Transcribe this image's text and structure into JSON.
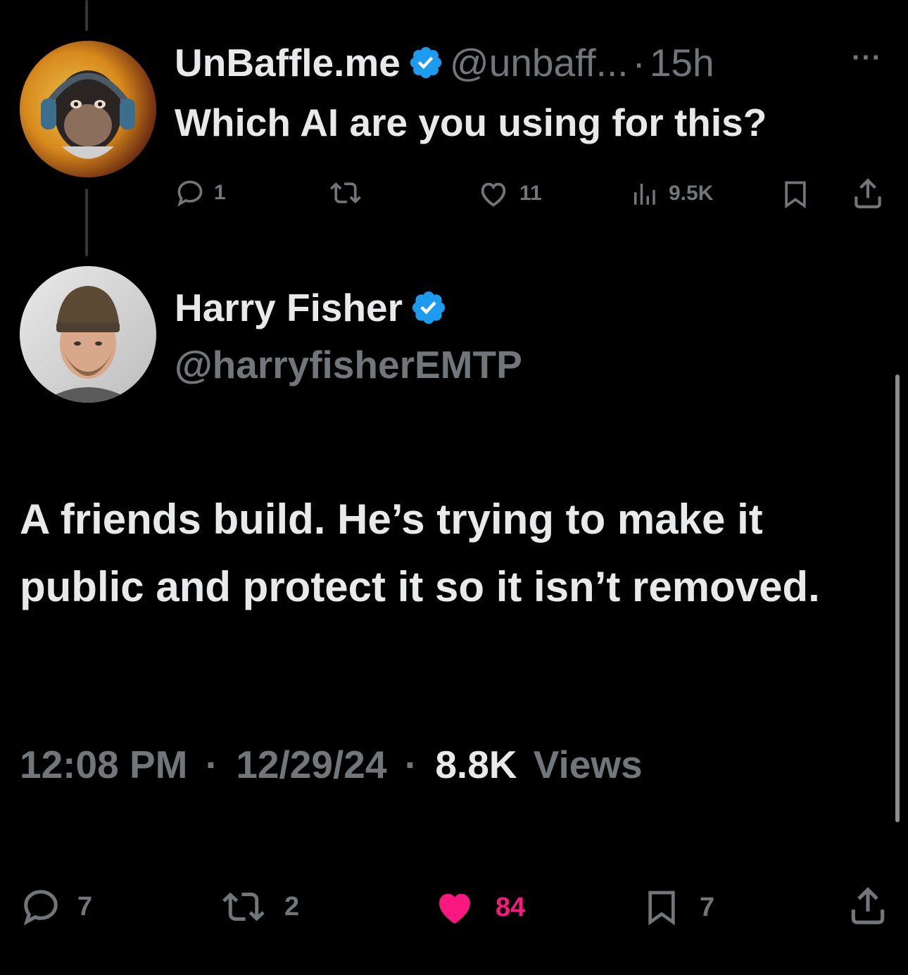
{
  "reply": {
    "display_name": "UnBaffle.me",
    "handle": "@unbaff...",
    "separator": "·",
    "time": "15h",
    "more_label": "···",
    "text": "Which AI are you using for this?",
    "actions": {
      "replies": "1",
      "reposts": "",
      "likes": "11",
      "views": "9.5K"
    }
  },
  "main": {
    "display_name": "Harry Fisher",
    "handle": "@harryfisherEMTP",
    "text": "A friends build. He’s trying to make it public and protect it so it isn’t removed.",
    "timestamp": {
      "time": "12:08 PM",
      "sep1": "·",
      "date": "12/29/24",
      "sep2": "·",
      "views_count": "8.8K",
      "views_label": "Views"
    },
    "actions": {
      "replies": "7",
      "reposts": "2",
      "likes": "84",
      "bookmarks": "7"
    }
  },
  "colors": {
    "background": "#000000",
    "text": "#e7e9ea",
    "muted": "#71767b",
    "verified": "#1d9bf0",
    "liked": "#f91880"
  },
  "icons": {
    "verified": "verified-badge-icon",
    "reply": "reply-bubble-icon",
    "repost": "repost-icon",
    "like": "heart-icon",
    "views": "views-bar-chart-icon",
    "bookmark": "bookmark-icon",
    "share": "share-upload-icon",
    "more": "more-dots-icon"
  }
}
